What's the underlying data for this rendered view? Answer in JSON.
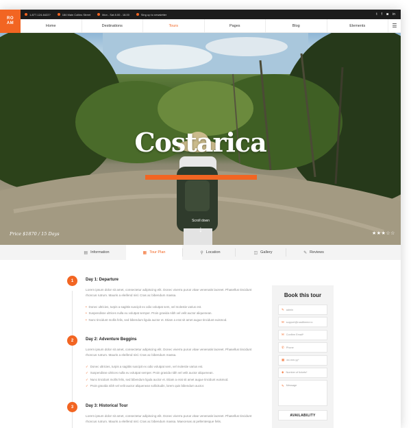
{
  "logo": {
    "line1": "RO",
    "line2": "AM"
  },
  "topbar": {
    "phone": "1-877-124-6422?",
    "address": "184 Main Collins Street",
    "hours": "Mon - Sat 8.00 - 18.00",
    "newsletter": "Sing up to newsletter",
    "social": [
      "twitter-icon",
      "facebook-icon",
      "instagram-icon",
      "linkedin-icon"
    ]
  },
  "nav": {
    "items": [
      "Home",
      "Destinations",
      "Tours",
      "Pages",
      "Blog",
      "Elements"
    ],
    "active": "Tours",
    "menu_icon": "hamburger-icon"
  },
  "hero": {
    "title": "Costarica",
    "price": "Price $1870 / 15 Days",
    "scroll": "Scroll down",
    "rating": 3,
    "rating_max": 5
  },
  "tabs": [
    {
      "label": "Information",
      "icon": "file-icon"
    },
    {
      "label": "Tour Plan",
      "icon": "calendar-icon",
      "active": true
    },
    {
      "label": "Location",
      "icon": "map-pin-icon"
    },
    {
      "label": "Gallery",
      "icon": "camera-icon"
    },
    {
      "label": "Reviews",
      "icon": "chat-icon"
    }
  ],
  "days": [
    {
      "number": "1",
      "title": "Day 1: Departure",
      "text": "Lorem ipsum dolor sit amet, consectetur adipiscing elit. Donec viverra purus vitae venenatis laoreet. Phasellus tincidunt rhoncus rutrum. Mauris a eleifend nisl. Cras ac bibendum massa.",
      "bullets": [
        "Donec ultricies, turpis a sagittis suscipit ex odio volutpat sem, vel molestie varius est.",
        "Suspendisse ultrices nulla eu volutpat semper. Proin gravida nibh vel velit auctor aliquenean.",
        "Nunc tincidunt mollis felis, sed bibendum ligula auctor et. Etiam a erat sit amet augue tincidunt euismod."
      ]
    },
    {
      "number": "2",
      "title": "Day 2: Adventure Beggins",
      "text": "Lorem ipsum dolor sit amet, consectetur adipiscing elit. Donec viverra purus vitae venenatis laoreet. Phasellus tincidunt rhoncus rutrum. Mauris a eleifend nisl. Cras ac bibendum massa.",
      "bullets": [
        "Donec ultricies, turpis a sagittis suscipit ex odio volutpat sem, vel molestie varius est.",
        "Suspendisse ultrices nulla eu volutpat semper. Proin gravida nibh vel velit auctor aliquenean.",
        "Nunc tincidunt mollis felis, sed bibendum ligula auctor et. Etiam a erat sit amet augue tincidunt euismod.",
        "Proin gravida nibh vel velit auctor aliquenean sollicitudin, lorem quis bibendum auctor."
      ]
    },
    {
      "number": "3",
      "title": "Day 3: Historical Tour",
      "text": "Lorem ipsum dolor sit amet, consectetur adipiscing elit. Donec viverra purus vitae venenatis laoreet. Phasellus tincidunt rhoncus rutrum. Mauris a eleifend nisl. Cras ac bibendum massa. Maecenas at pellentesque felis.",
      "bullets": []
    }
  ],
  "booking": {
    "title": "Book this tour",
    "fields": [
      {
        "placeholder": "admin",
        "icon": "user-icon"
      },
      {
        "placeholder": "support@roadtheme.io",
        "icon": "mail-icon"
      },
      {
        "placeholder": "Confirm Email*",
        "icon": "mail-icon"
      },
      {
        "placeholder": "Phone",
        "icon": "phone-icon"
      },
      {
        "placeholder": "dd-mm-yy*",
        "icon": "calendar-icon"
      },
      {
        "placeholder": "Number of tickets*",
        "icon": "ticket-icon"
      }
    ],
    "message_placeholder": "Message",
    "button": "AVAILABILITY"
  },
  "colors": {
    "accent": "#f26522",
    "dark": "#1c1c1c"
  }
}
